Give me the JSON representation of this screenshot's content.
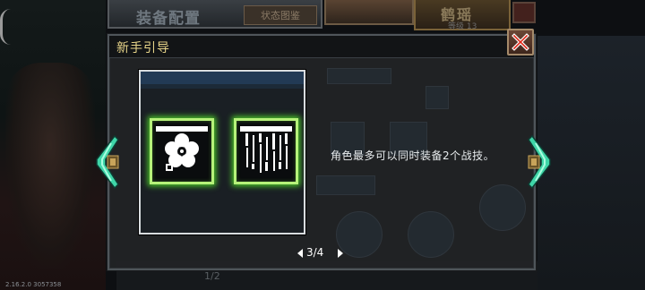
{
  "background": {
    "panel_title": "装备配置",
    "config_button": "状态图鉴",
    "character_name": "鹤瑶",
    "character_level": "等级 13",
    "page_indicator": "1/2",
    "version": "2.16.2.0 3057358"
  },
  "guide": {
    "title": "新手引导",
    "tip": "角色最多可以同时装备2个战技。",
    "page": "3/4"
  },
  "icons": {
    "close": "close-x-icon",
    "slot_1": "plum-blossom-skill-icon",
    "slot_2": "falling-blades-skill-icon",
    "nav_prev": "arrow-left-icon",
    "nav_next": "arrow-right-icon"
  },
  "colors": {
    "title_gold": "#e8d58a",
    "slot_glow": "#b6f27a",
    "nav_teal": "#3fd6a8",
    "close_red": "#e02a1a"
  }
}
